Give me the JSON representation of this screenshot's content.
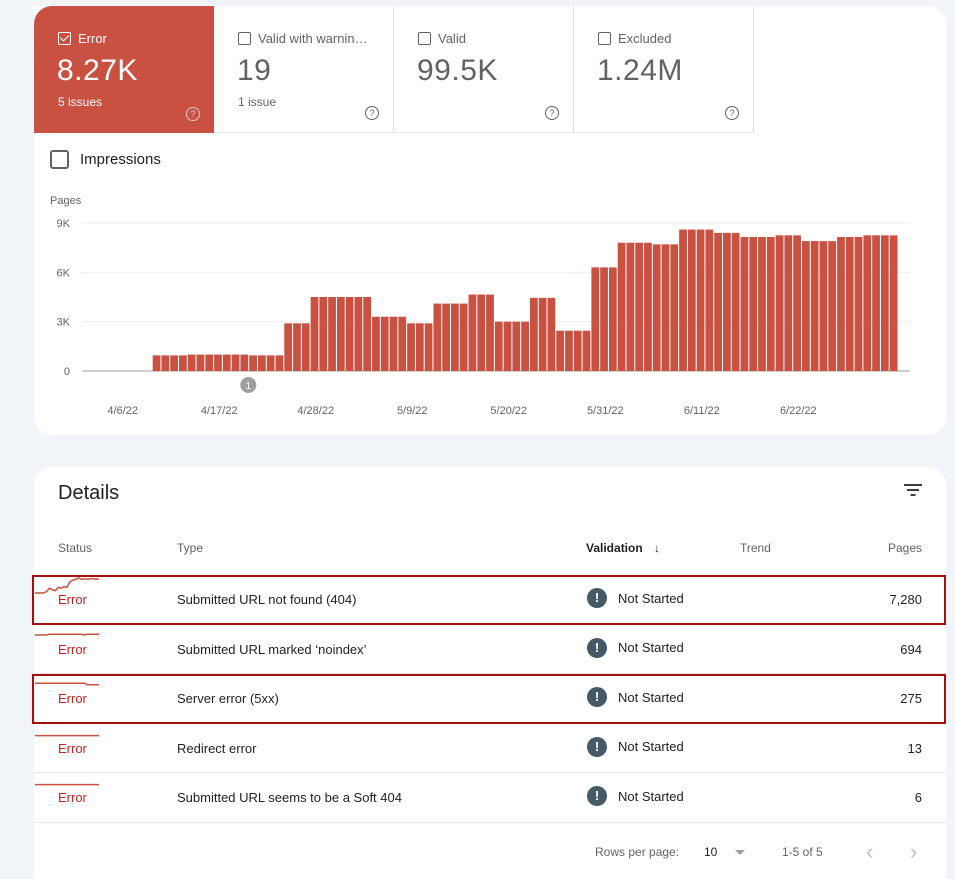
{
  "tiles": [
    {
      "label": "Error",
      "value": "8.27K",
      "sub": "5 issues",
      "checked": true
    },
    {
      "label": "Valid with warnin…",
      "value": "19",
      "sub": "1 issue",
      "checked": false
    },
    {
      "label": "Valid",
      "value": "99.5K",
      "sub": "",
      "checked": false
    },
    {
      "label": "Excluded",
      "value": "1.24M",
      "sub": "",
      "checked": false
    }
  ],
  "help_icon": "?",
  "impressions_label": "Impressions",
  "colors": {
    "error": "#c95142",
    "error_text": "#c5221f",
    "highlight": "#a50e0e"
  },
  "chart_data": {
    "type": "bar",
    "title": "",
    "ylabel": "Pages",
    "xlabel": "",
    "ylim": [
      0,
      9000
    ],
    "yticks": [
      "0",
      "3K",
      "6K",
      "9K"
    ],
    "ytick_values": [
      0,
      3000,
      6000,
      9000
    ],
    "xtick_labels": [
      "4/6/22",
      "4/17/22",
      "4/28/22",
      "5/9/22",
      "5/20/22",
      "5/31/22",
      "6/11/22",
      "6/22/22"
    ],
    "start_date": "4/3/22",
    "annotation": {
      "label": "1",
      "date_index": 18
    },
    "values": [
      0,
      0,
      0,
      0,
      0,
      0,
      0,
      0,
      950,
      950,
      950,
      950,
      1000,
      1000,
      1000,
      1000,
      1000,
      1000,
      1000,
      950,
      950,
      950,
      950,
      2900,
      2900,
      2900,
      4500,
      4500,
      4500,
      4500,
      4500,
      4500,
      4500,
      3300,
      3300,
      3300,
      3300,
      2900,
      2900,
      2900,
      4100,
      4100,
      4100,
      4100,
      4650,
      4650,
      4650,
      3000,
      3000,
      3000,
      3000,
      4450,
      4450,
      4450,
      2450,
      2450,
      2450,
      2450,
      6300,
      6300,
      6300,
      7800,
      7800,
      7800,
      7800,
      7700,
      7700,
      7700,
      8600,
      8600,
      8600,
      8600,
      8400,
      8400,
      8400,
      8150,
      8150,
      8150,
      8150,
      8250,
      8250,
      8250,
      7900,
      7900,
      7900,
      7900,
      8150,
      8150,
      8150,
      8250,
      8250,
      8250,
      8250
    ]
  },
  "details": {
    "title": "Details",
    "columns": {
      "status": "Status",
      "type": "Type",
      "validation": "Validation",
      "trend": "Trend",
      "pages": "Pages"
    },
    "sort_icon": "↓",
    "rows": [
      {
        "status": "Error",
        "type": "Submitted URL not found (404)",
        "validation": "Not Started",
        "pages": "7,280",
        "highlighted": true,
        "trend": [
          0,
          0,
          0,
          0,
          0.1,
          0.3,
          0.2,
          0.15,
          0.35,
          0.3,
          0.4,
          0.35,
          0.7,
          0.8,
          0.85,
          0.95,
          0.85,
          0.9,
          0.85,
          0.9,
          0.9,
          0.85,
          0.9
        ]
      },
      {
        "status": "Error",
        "type": "Submitted URL marked ‘noindex’",
        "validation": "Not Started",
        "pages": "694",
        "highlighted": false,
        "trend": [
          0.5,
          0.5,
          0.5,
          0.5,
          0.5,
          0.55,
          0.55,
          0.55,
          0.55,
          0.55,
          0.55,
          0.55,
          0.55,
          0.55,
          0.55,
          0.55,
          0.55,
          0.5,
          0.55,
          0.55,
          0.55,
          0.55,
          0.55
        ]
      },
      {
        "status": "Error",
        "type": "Server error (5xx)",
        "validation": "Not Started",
        "pages": "275",
        "highlighted": true,
        "trend": [
          0.55,
          0.55,
          0.55,
          0.55,
          0.55,
          0.55,
          0.55,
          0.55,
          0.55,
          0.55,
          0.55,
          0.55,
          0.55,
          0.55,
          0.55,
          0.55,
          0.55,
          0.55,
          0.45,
          0.45,
          0.45,
          0.45,
          0.45
        ]
      },
      {
        "status": "Error",
        "type": "Redirect error",
        "validation": "Not Started",
        "pages": "13",
        "highlighted": false,
        "trend": [
          0.4,
          0.4,
          0.4,
          0.4,
          0.4,
          0.4,
          0.4,
          0.4,
          0.4,
          0.4,
          0.4,
          0.4,
          0.4,
          0.4,
          0.4,
          0.4,
          0.4,
          0.4,
          0.4,
          0.4,
          0.4,
          0.4,
          0.4
        ]
      },
      {
        "status": "Error",
        "type": "Submitted URL seems to be a Soft 404",
        "validation": "Not Started",
        "pages": "6",
        "highlighted": false,
        "trend": [
          0.4,
          0.4,
          0.4,
          0.4,
          0.4,
          0.4,
          0.4,
          0.4,
          0.4,
          0.4,
          0.4,
          0.4,
          0.4,
          0.4,
          0.4,
          0.4,
          0.4,
          0.4,
          0.4,
          0.4,
          0.4,
          0.4,
          0.4
        ]
      }
    ]
  },
  "pagination": {
    "rows_per_page_label": "Rows per page:",
    "rows_per_page_value": "10",
    "range_label": "1-5 of 5",
    "prev_icon": "‹",
    "next_icon": "›"
  }
}
